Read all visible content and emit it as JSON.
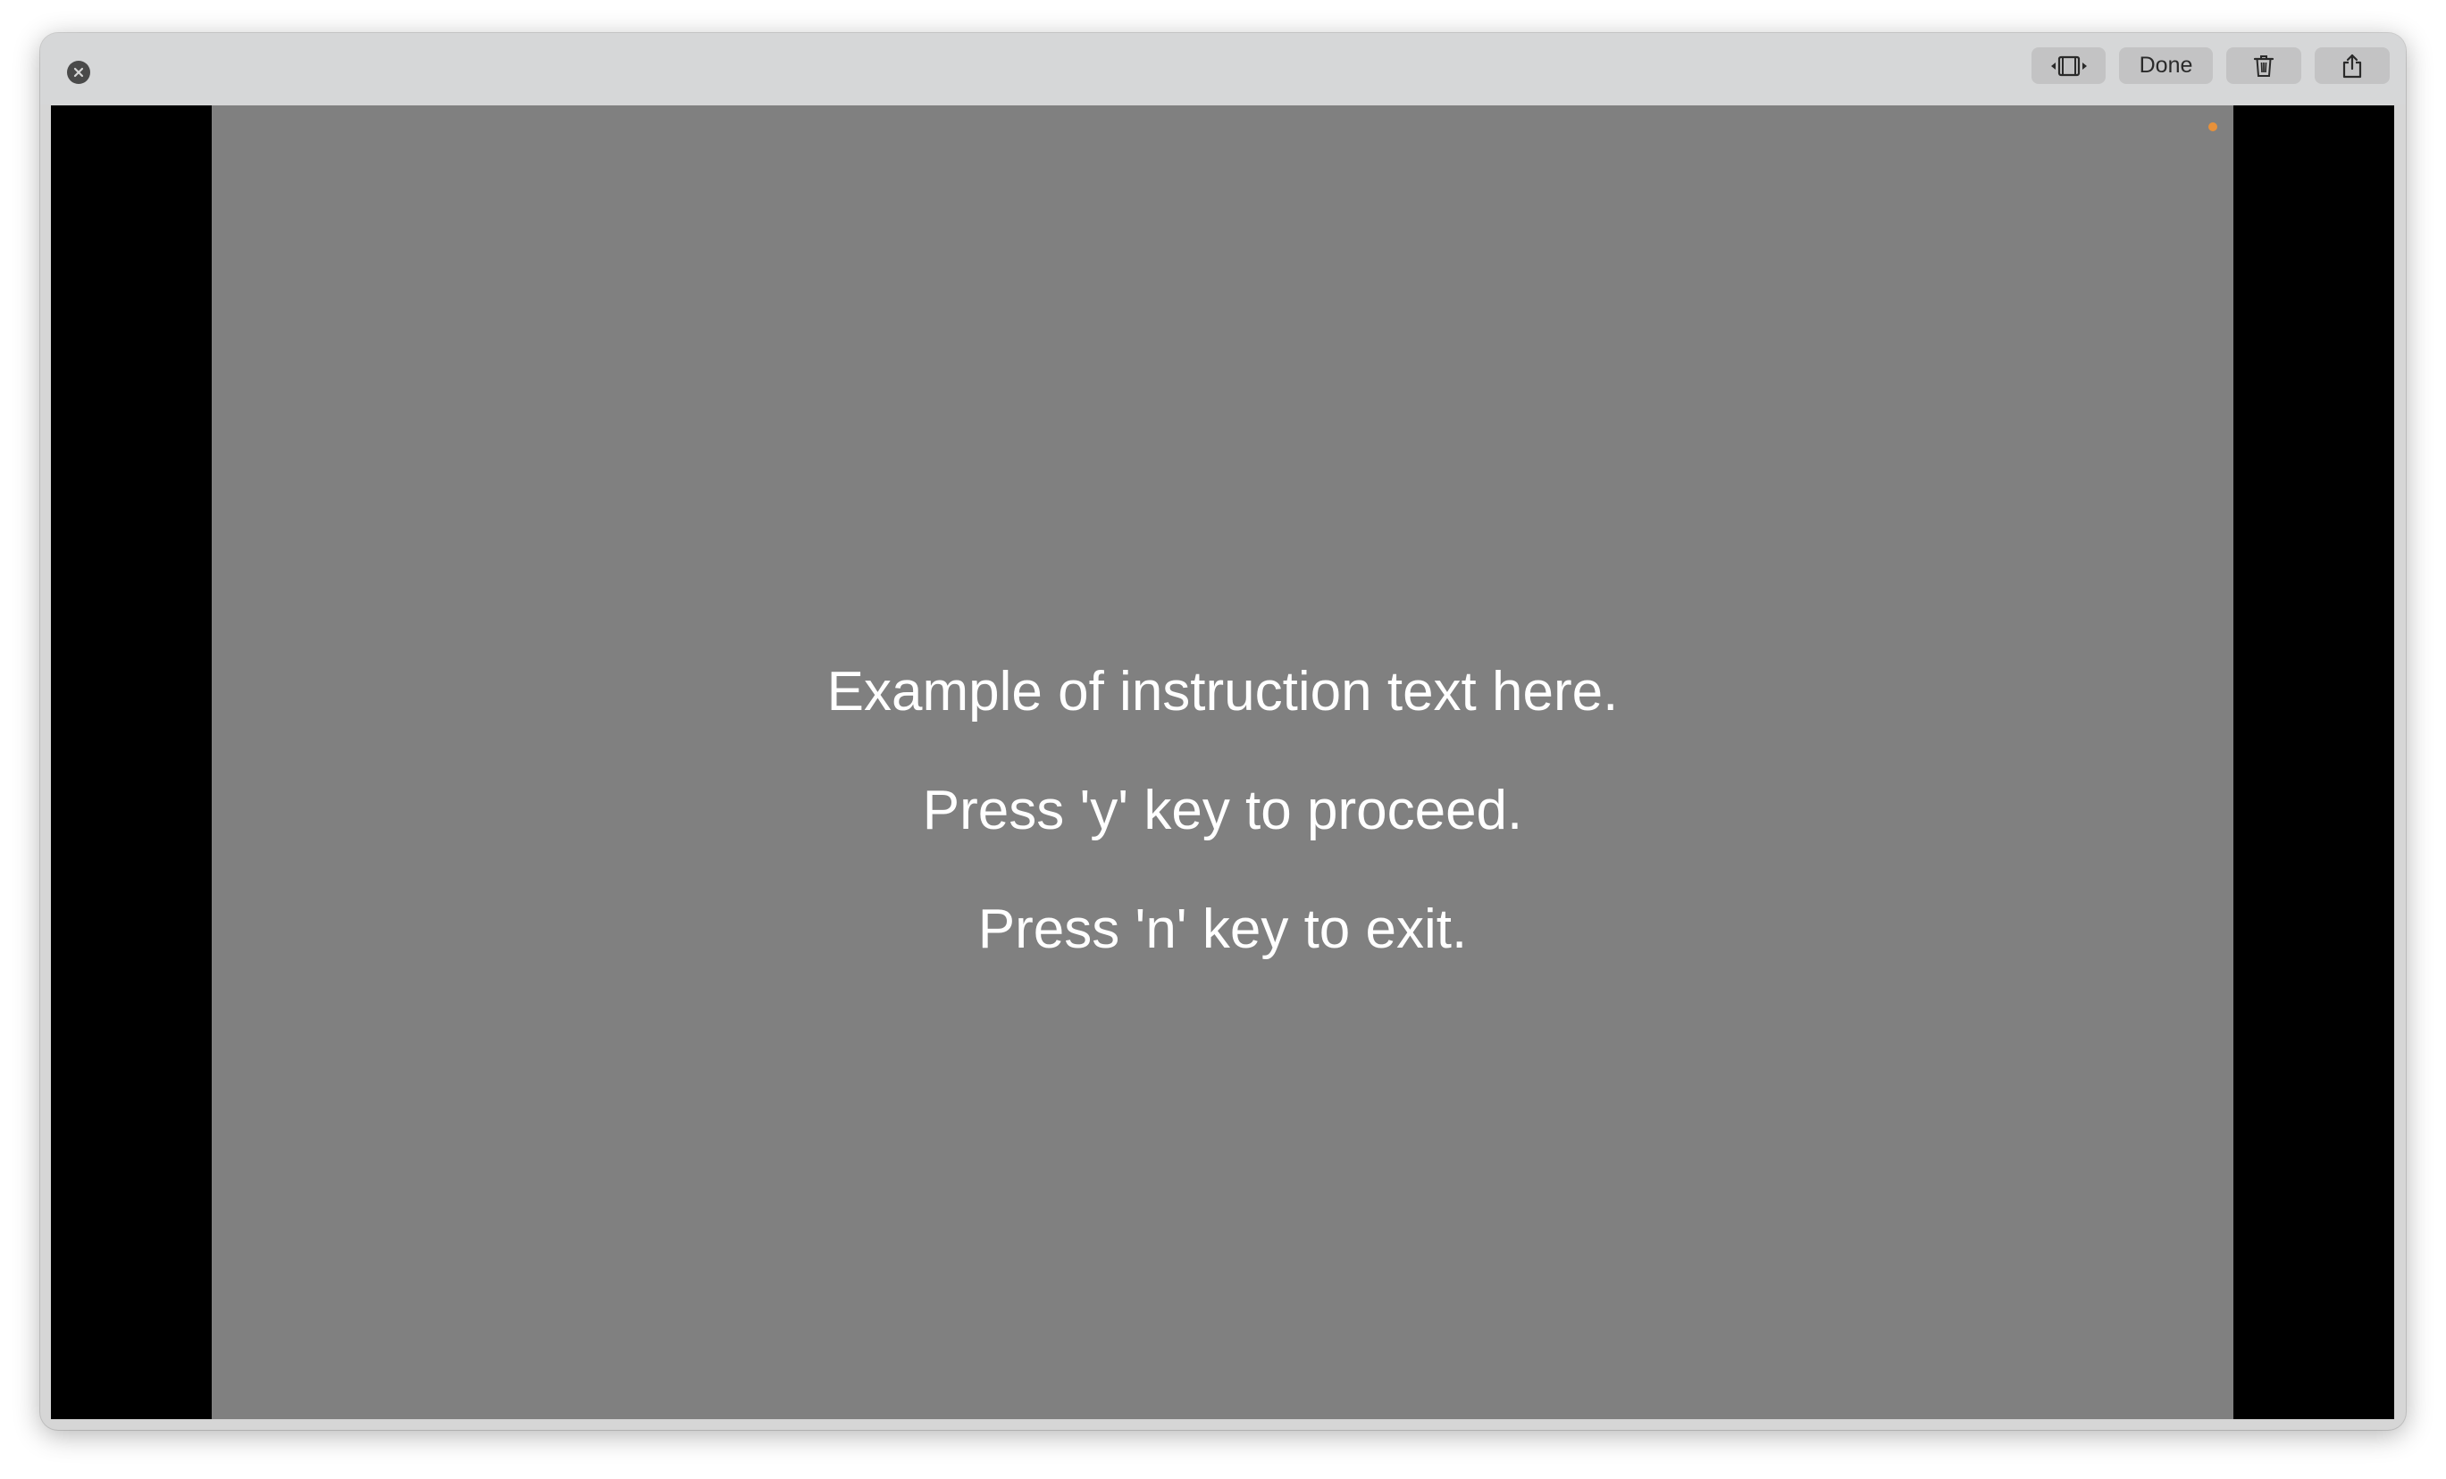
{
  "window": {
    "close_icon": "close-icon",
    "toolbar": {
      "trim_icon": "trim-icon",
      "done_label": "Done",
      "trash_icon": "trash-icon",
      "share_icon": "share-icon"
    }
  },
  "stage": {
    "background_color": "#808080",
    "text_color": "#ffffff",
    "indicator_color": "#e8913a",
    "lines": [
      "Example of instruction text here.",
      "Press 'y' key to proceed.",
      "Press 'n' key to exit."
    ]
  }
}
